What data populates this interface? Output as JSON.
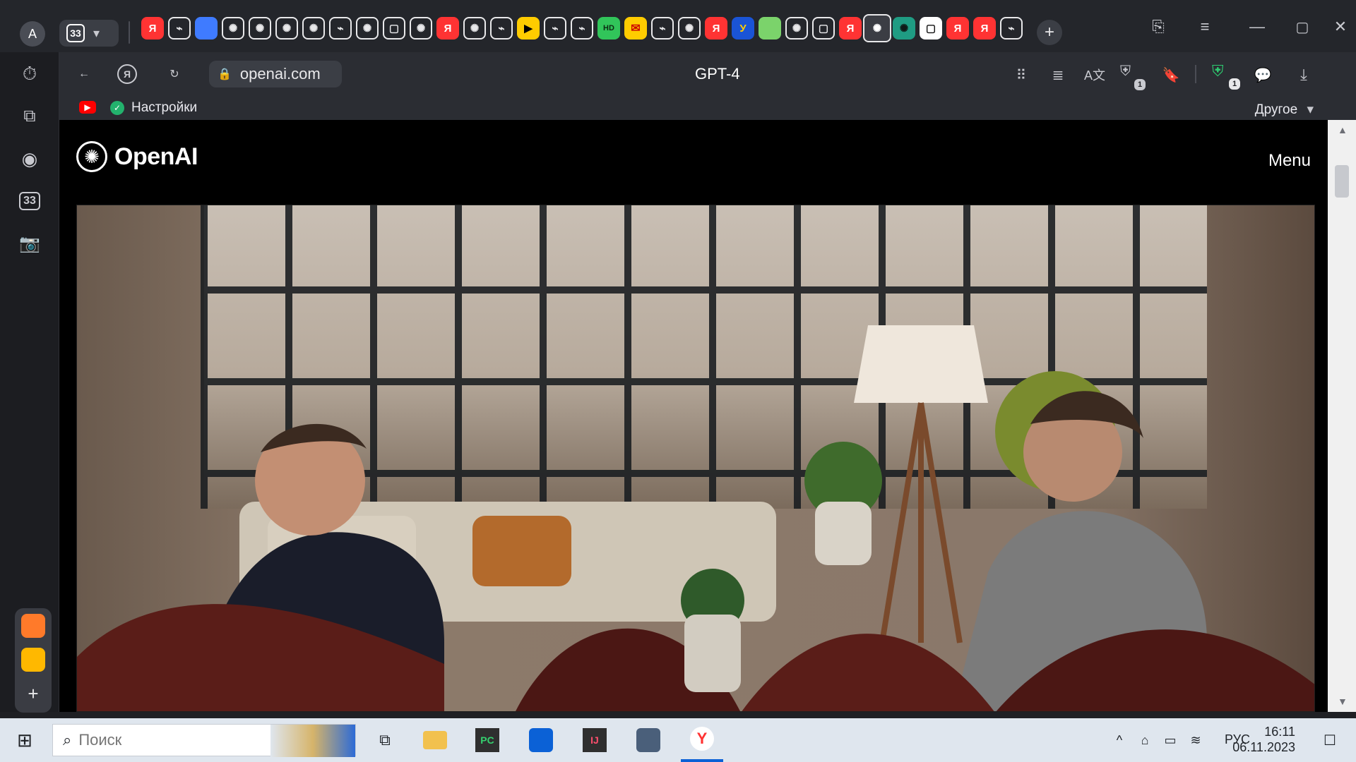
{
  "browser": {
    "profile_initial": "A",
    "tab_count": "33",
    "tab_title": "GPT-4",
    "url": "openai.com",
    "bookmarks": {
      "settings": "Настройки",
      "other": "Другое"
    },
    "notification_counts": {
      "security": "1",
      "shield": "1"
    }
  },
  "website": {
    "brand": "OpenAI",
    "menu": "Menu"
  },
  "sidebar": {
    "count": "33"
  },
  "taskbar": {
    "search_placeholder": "Поиск",
    "lang": "РУС",
    "time": "16:11",
    "date": "06.11.2023"
  },
  "colors": {
    "accent": "#0b61d6",
    "yandex_red": "#ff3333",
    "youtube_red": "#ff0000"
  },
  "icons": {
    "tabs": [
      "yandex-icon",
      "github-icon",
      "app-icon",
      "openai-icon",
      "openai-icon",
      "openai-icon",
      "openai-icon",
      "github-icon",
      "openai-icon",
      "document-icon",
      "openai-icon",
      "yandex-red-icon",
      "openai-icon",
      "github-icon",
      "play-icon",
      "github-icon",
      "github-icon",
      "hd-icon",
      "mail-icon",
      "github-icon",
      "openai-icon",
      "yandex-icon",
      "y-blue-icon",
      "green-icon",
      "openai-icon",
      "document-icon",
      "yandex-icon",
      "openai-icon",
      "chatgpt-icon",
      "document-icon",
      "yandex-icon",
      "yandex-icon",
      "github-icon"
    ]
  }
}
